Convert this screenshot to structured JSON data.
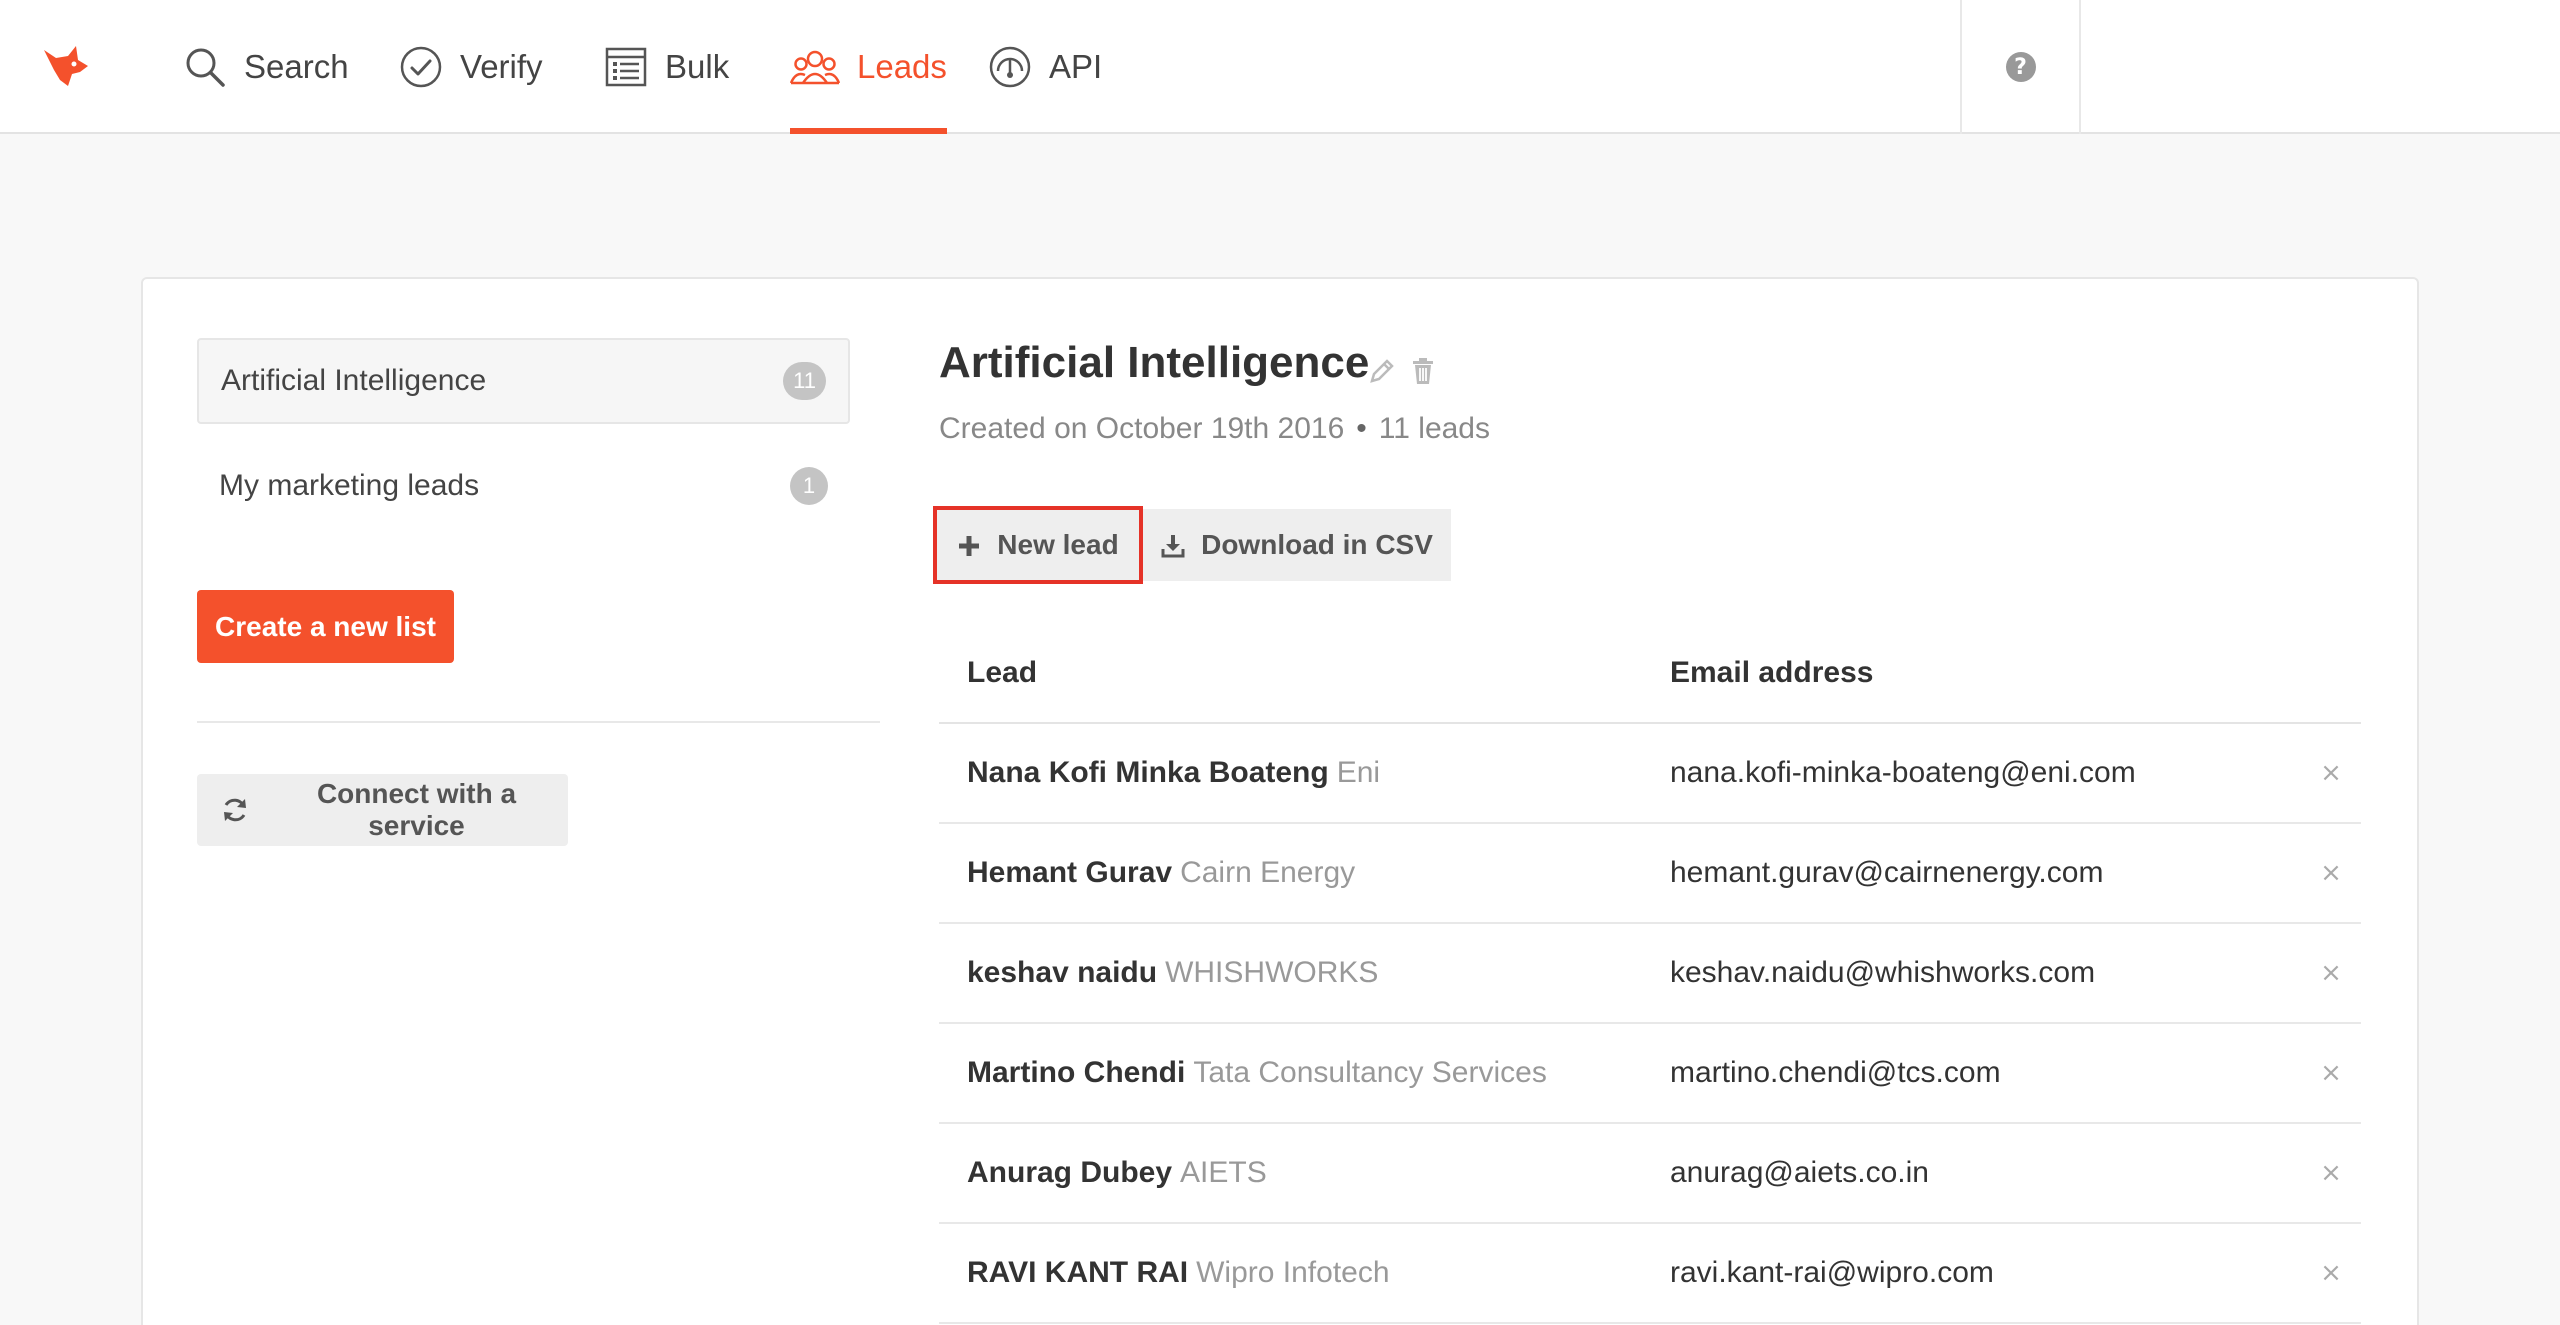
{
  "nav": {
    "items": [
      {
        "label": "Search",
        "icon": "search-icon"
      },
      {
        "label": "Verify",
        "icon": "check-circle-icon"
      },
      {
        "label": "Bulk",
        "icon": "list-icon"
      },
      {
        "label": "Leads",
        "icon": "users-icon",
        "active": true
      },
      {
        "label": "API",
        "icon": "gauge-icon"
      }
    ],
    "help_icon": "question-icon",
    "accent_color": "#f4512c"
  },
  "sidebar": {
    "lists": [
      {
        "name": "Artificial Intelligence",
        "count": "11",
        "selected": true
      },
      {
        "name": "My marketing leads",
        "count": "1",
        "selected": false
      }
    ],
    "create_label": "Create a new list",
    "connect_label": "Connect with a service"
  },
  "list": {
    "title": "Artificial Intelligence",
    "created": "Created on October 19th 2016",
    "separator": "•",
    "count_label": "11 leads",
    "new_lead_label": "New lead",
    "download_label": "Download in CSV"
  },
  "table": {
    "headers": {
      "lead": "Lead",
      "email": "Email address"
    },
    "rows": [
      {
        "name": "Nana Kofi Minka Boateng",
        "company": "Eni",
        "email": "nana.kofi-minka-boateng@eni.com"
      },
      {
        "name": "Hemant Gurav",
        "company": "Cairn Energy",
        "email": "hemant.gurav@cairnenergy.com"
      },
      {
        "name": "keshav naidu",
        "company": "WHISHWORKS",
        "email": "keshav.naidu@whishworks.com"
      },
      {
        "name": "Martino Chendi",
        "company": "Tata Consultancy Services",
        "email": "martino.chendi@tcs.com"
      },
      {
        "name": "Anurag Dubey",
        "company": "AIETS",
        "email": "anurag@aiets.co.in"
      },
      {
        "name": "RAVI KANT RAI",
        "company": "Wipro Infotech",
        "email": "ravi.kant-rai@wipro.com"
      }
    ],
    "remove_glyph": "×"
  }
}
